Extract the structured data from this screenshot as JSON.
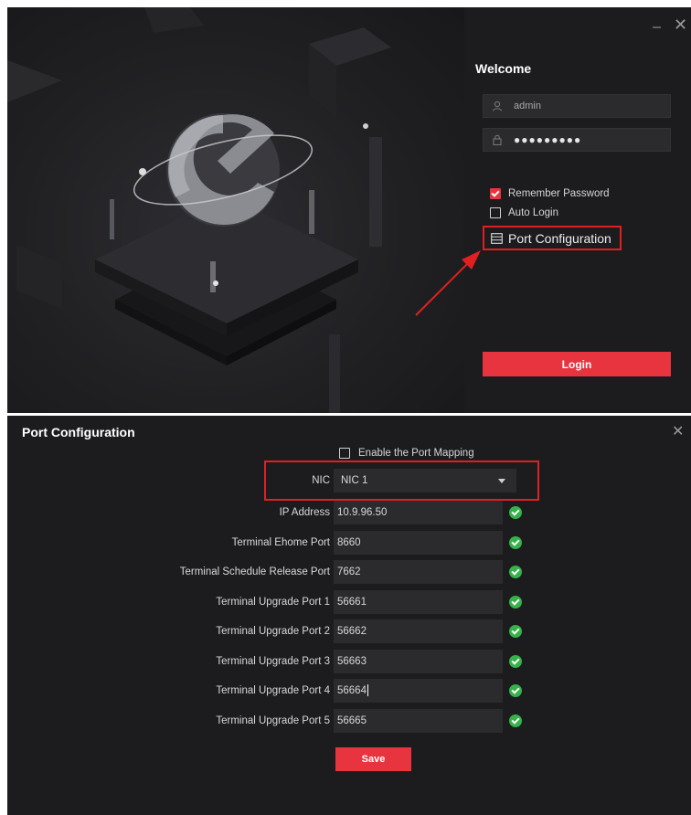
{
  "window_controls": {
    "minimize": "–",
    "close": "✕"
  },
  "login": {
    "welcome": "Welcome",
    "username_value": "admin",
    "password_value": "●●●●●●●●●",
    "remember_password": {
      "label": "Remember Password",
      "checked": true
    },
    "auto_login": {
      "label": "Auto Login",
      "checked": false
    },
    "port_configuration_link": "Port Configuration",
    "login_button": "Login",
    "icons": [
      "user-icon",
      "lock-icon",
      "port-config-icon"
    ]
  },
  "port_dialog": {
    "title": "Port Configuration",
    "close": "✕",
    "enable_port_mapping": {
      "label": "Enable the Port Mapping",
      "checked": false
    },
    "nic": {
      "label": "NIC",
      "value": "NIC 1"
    },
    "fields": [
      {
        "label": "IP Address",
        "value": "10.9.96.50",
        "valid": true
      },
      {
        "label": "Terminal Ehome Port",
        "value": "8660",
        "valid": true
      },
      {
        "label": "Terminal Schedule Release Port",
        "value": "7662",
        "valid": true
      },
      {
        "label": "Terminal Upgrade Port 1",
        "value": "56661",
        "valid": true
      },
      {
        "label": "Terminal Upgrade Port 2",
        "value": "56662",
        "valid": true
      },
      {
        "label": "Terminal Upgrade Port 3",
        "value": "56663",
        "valid": true
      },
      {
        "label": "Terminal Upgrade Port 4",
        "value": "56664",
        "valid": true
      },
      {
        "label": "Terminal Upgrade Port 5",
        "value": "56665",
        "valid": true
      }
    ],
    "save_button": "Save"
  },
  "colors": {
    "accent": "#e7343f",
    "highlight_border": "#e02020",
    "valid": "#35b24a",
    "background": "#1c1c1f"
  }
}
